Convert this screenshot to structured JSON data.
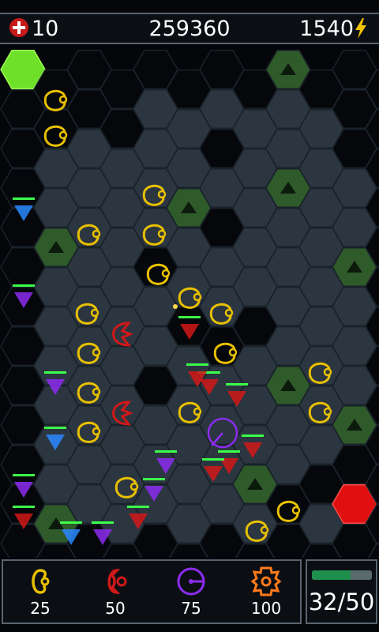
{
  "hud": {
    "lives": "10",
    "score": "259360",
    "energy": "1540",
    "life_icon": "red-cross-icon",
    "energy_icon": "lightning-icon"
  },
  "shop": {
    "items": [
      {
        "name": "yellow-cell-tower",
        "cost": "25",
        "color": "#e8c000"
      },
      {
        "name": "red-arrow-tower",
        "cost": "50",
        "color": "#d21818"
      },
      {
        "name": "purple-radar-tower",
        "cost": "75",
        "color": "#8c2cf0"
      },
      {
        "name": "orange-gear-tower",
        "cost": "100",
        "color": "#ff7a1a"
      }
    ]
  },
  "wave": {
    "text": "32/50",
    "progress": 0.64
  },
  "colors": {
    "tile": "#2c3640",
    "dark_tile": "#05070a",
    "hill": "#2f5a2a",
    "spawn": "#6fe02a",
    "exit": "#e01010",
    "tower_yellow": "#e8c000",
    "tower_red": "#d21818",
    "tower_purple": "#8c2cf0"
  }
}
